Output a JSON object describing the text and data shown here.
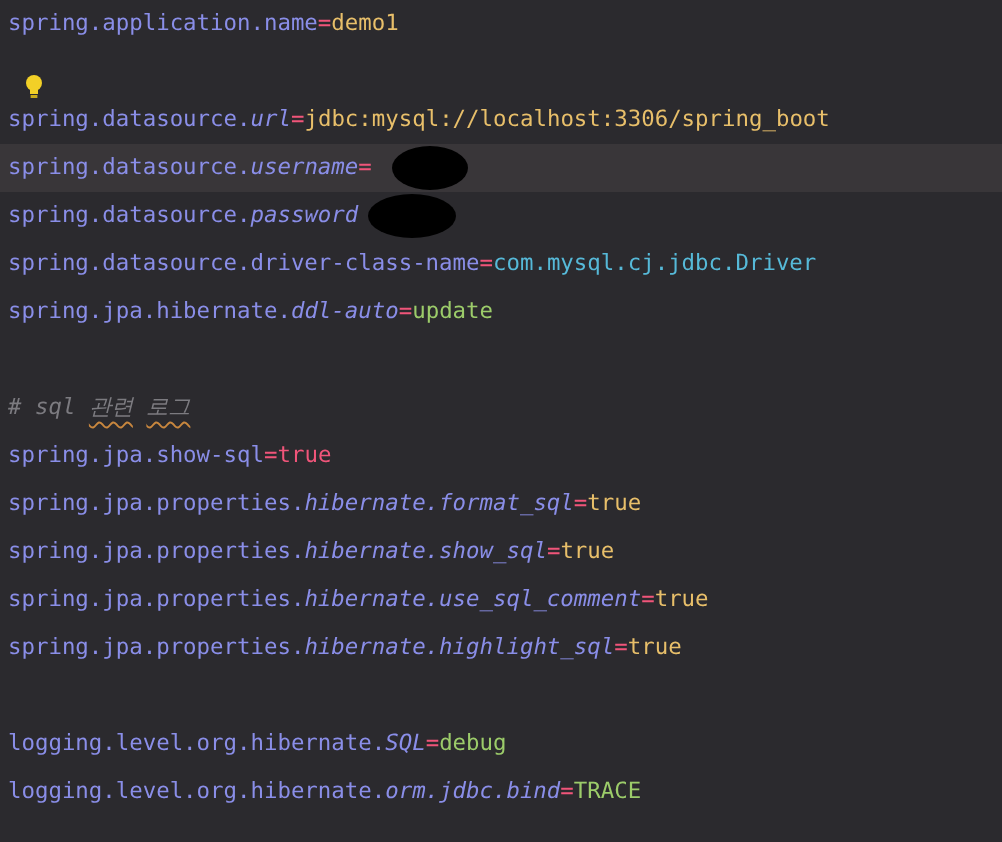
{
  "editor": {
    "lines": [
      {
        "kind": "property",
        "key": "spring.application.name",
        "separator": "=",
        "value": "demo1",
        "color": "#e8bf6a"
      },
      {
        "kind": "blank"
      },
      {
        "kind": "property",
        "key": "spring.datasource.*url*",
        "separator": "=",
        "value": "jdbc:mysql://localhost:3306/spring_boot",
        "color": "#e8bf6a",
        "bulb": true
      },
      {
        "kind": "property",
        "key": "spring.datasource.*username*",
        "separator": "=",
        "current": true,
        "redacted": true
      },
      {
        "kind": "property",
        "key": "spring.datasource.*password*",
        "redacted": true
      },
      {
        "kind": "property",
        "key": "spring.datasource.driver-class-name",
        "separator": "=",
        "value": "com.mysql.cj.jdbc.Driver",
        "color": "#56b9d8"
      },
      {
        "kind": "property",
        "key": "spring.jpa.hibernate.*ddl-auto*",
        "separator": "=",
        "value": "update",
        "color": "#9ccc6a"
      },
      {
        "kind": "blank"
      },
      {
        "kind": "comment",
        "text": "# sql",
        "flagged": [
          "관련",
          "로그"
        ]
      },
      {
        "kind": "property",
        "key": "spring.jpa.show-sql",
        "separator": "=",
        "value": "true",
        "color": "#f0557a"
      },
      {
        "kind": "property",
        "key": "spring.jpa.properties.*hibernate.format_sql*",
        "separator": "=",
        "value": "true",
        "color": "#e8bf6a"
      },
      {
        "kind": "property",
        "key": "spring.jpa.properties.*hibernate.show_sql*",
        "separator": "=",
        "value": "true",
        "color": "#e8bf6a"
      },
      {
        "kind": "property",
        "key": "spring.jpa.properties.*hibernate.use_sql_comment*",
        "separator": "=",
        "value": "true",
        "color": "#e8bf6a"
      },
      {
        "kind": "property",
        "key": "spring.jpa.properties.*hibernate.highlight_sql*",
        "separator": "=",
        "value": "true",
        "color": "#e8bf6a"
      },
      {
        "kind": "blank"
      },
      {
        "kind": "property",
        "key": "logging.level.org.hibernate.*SQL*",
        "separator": "=",
        "value": "debug",
        "color": "#9ccc6a"
      },
      {
        "kind": "property",
        "key": "logging.level.org.hibernate.*orm.jdbc.bind*",
        "separator": "=",
        "value": "TRACE",
        "color": "#9ccc6a"
      }
    ]
  }
}
